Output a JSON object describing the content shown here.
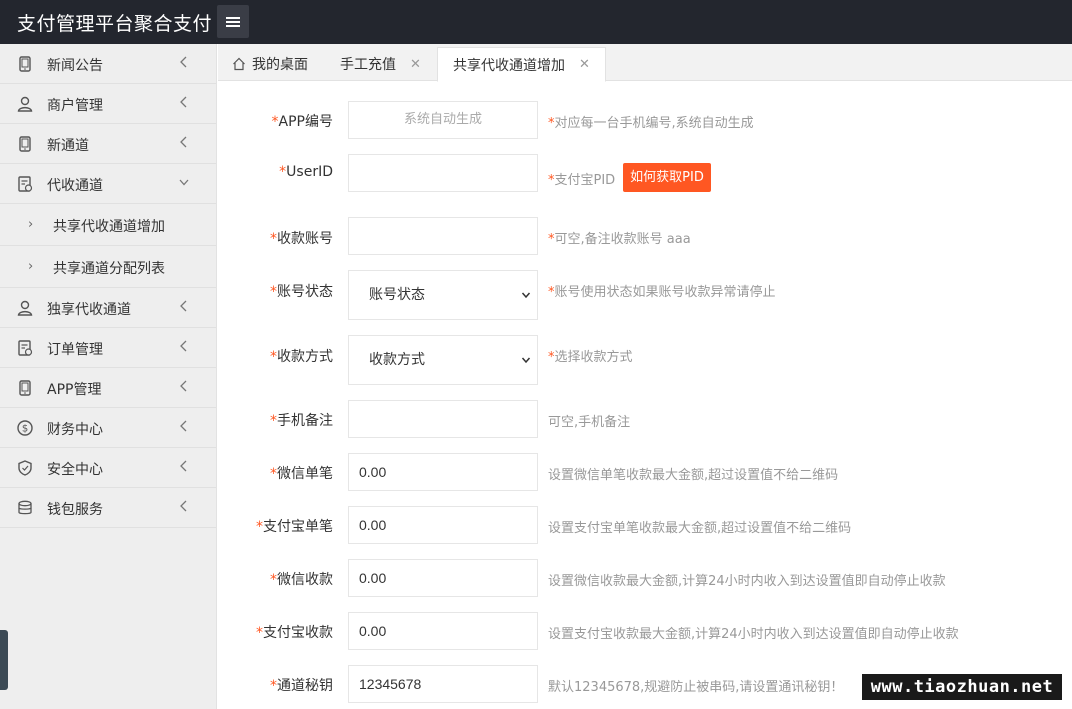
{
  "header": {
    "title": "支付管理平台聚合支付"
  },
  "sidebar": {
    "items": [
      {
        "label": "新闻公告",
        "icon": "phone-icon"
      },
      {
        "label": "商户管理",
        "icon": "user-icon"
      },
      {
        "label": "新通道",
        "icon": "phone-icon"
      },
      {
        "label": "代收通道",
        "icon": "clipboard-icon",
        "expanded": true
      },
      {
        "label": "独享代收通道",
        "icon": "user-icon"
      },
      {
        "label": "订单管理",
        "icon": "clipboard-icon"
      },
      {
        "label": "APP管理",
        "icon": "phone-icon"
      },
      {
        "label": "财务中心",
        "icon": "dollar-icon"
      },
      {
        "label": "安全中心",
        "icon": "shield-icon"
      },
      {
        "label": "钱包服务",
        "icon": "database-icon"
      }
    ],
    "subitems": [
      {
        "label": "共享代收通道增加"
      },
      {
        "label": "共享通道分配列表"
      }
    ]
  },
  "tabs": [
    {
      "label": "我的桌面",
      "closable": false
    },
    {
      "label": "手工充值",
      "closable": true,
      "close": "✕"
    },
    {
      "label": "共享代收通道增加",
      "closable": true,
      "active": true,
      "close": "✕"
    }
  ],
  "form": {
    "app_id": {
      "req": "*",
      "label": "APP编号",
      "placeholder": "系统自动生成",
      "hint_req": "*",
      "hint": "对应每一台手机编号,系统自动生成"
    },
    "user_id": {
      "req": "*",
      "label": "UserID",
      "value": "",
      "hint_req": "*",
      "hint": "支付宝PID",
      "button": "如何获取PID"
    },
    "account": {
      "req": "*",
      "label": "收款账号",
      "value": "",
      "hint_req": "*",
      "hint": "可空,备注收款账号 aaa"
    },
    "status": {
      "req": "*",
      "label": "账号状态",
      "selected": "账号状态",
      "hint_req": "*",
      "hint": "账号使用状态如果账号收款异常请停止"
    },
    "method": {
      "req": "*",
      "label": "收款方式",
      "selected": "收款方式",
      "hint_req": "*",
      "hint": "选择收款方式"
    },
    "phone_note": {
      "req": "*",
      "label": "手机备注",
      "value": "",
      "hint": "可空,手机备注"
    },
    "wechat_single": {
      "req": "*",
      "label": "微信单笔",
      "value": "0.00",
      "hint": "设置微信单笔收款最大金额,超过设置值不给二维码"
    },
    "alipay_single": {
      "req": "*",
      "label": "支付宝单笔",
      "value": "0.00",
      "hint": "设置支付宝单笔收款最大金额,超过设置值不给二维码"
    },
    "wechat_total": {
      "req": "*",
      "label": "微信收款",
      "value": "0.00",
      "hint": "设置微信收款最大金额,计算24小时内收入到达设置值即自动停止收款"
    },
    "alipay_total": {
      "req": "*",
      "label": "支付宝收款",
      "value": "0.00",
      "hint": "设置支付宝收款最大金额,计算24小时内收入到达设置值即自动停止收款"
    },
    "secret": {
      "req": "*",
      "label": "通道秘钥",
      "value": "12345678",
      "hint": "默认12345678,规避防止被串码,请设置通讯秘钥！"
    }
  },
  "watermark": "www.tiaozhuan.net",
  "colors": {
    "accent": "#ff5722",
    "topbar": "#23262e",
    "sidebar": "#eeeeee"
  }
}
